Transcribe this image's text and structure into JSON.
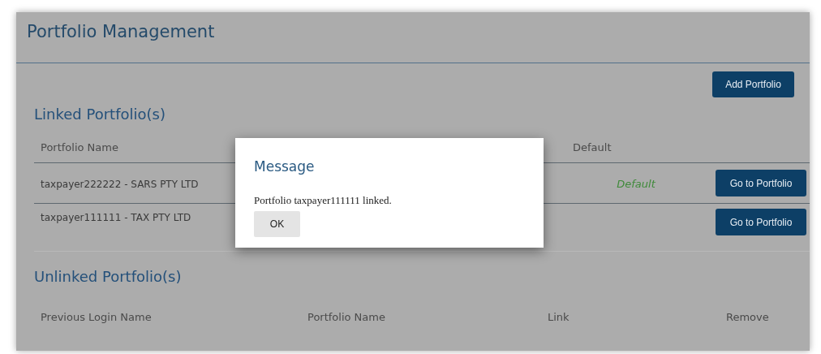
{
  "page": {
    "title": "Portfolio Management"
  },
  "add_button": "Add Portfolio",
  "linked": {
    "heading": "Linked Portfolio(s)",
    "columns": [
      "Portfolio Name",
      "Default"
    ],
    "rows": [
      {
        "name": "taxpayer222222 - SARS PTY LTD",
        "default": "Default",
        "button": "Go to Portfolio"
      },
      {
        "name": "taxpayer111111 - TAX PTY LTD",
        "button": "Go to Portfolio"
      }
    ]
  },
  "unlinked": {
    "heading": "Unlinked Portfolio(s)",
    "columns": [
      "Previous Login Name",
      "Portfolio Name",
      "Link",
      "Remove"
    ]
  },
  "dialog": {
    "title": "Message",
    "message": "Portfolio taxpayer111111 linked.",
    "button": "OK"
  }
}
